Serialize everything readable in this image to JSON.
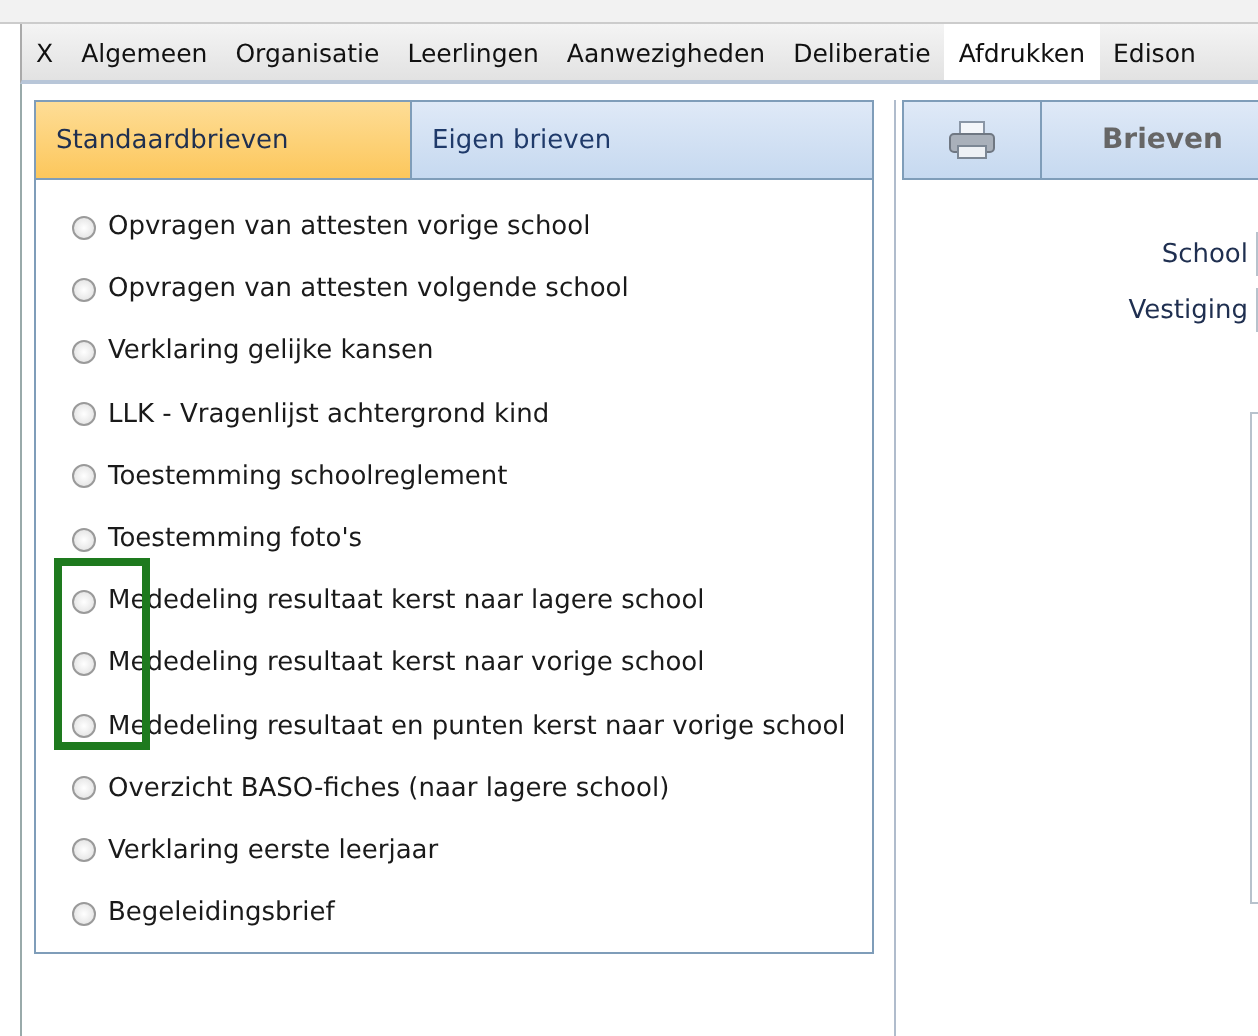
{
  "menu_tabs": [
    {
      "label": "X",
      "selected": false
    },
    {
      "label": "Algemeen",
      "selected": false
    },
    {
      "label": "Organisatie",
      "selected": false
    },
    {
      "label": "Leerlingen",
      "selected": false
    },
    {
      "label": "Aanwezigheden",
      "selected": false
    },
    {
      "label": "Deliberatie",
      "selected": false
    },
    {
      "label": "Afdrukken",
      "selected": true
    },
    {
      "label": "Edison",
      "selected": false
    }
  ],
  "letter_tabs": [
    {
      "label": "Standaardbrieven",
      "selected": true
    },
    {
      "label": "Eigen brieven",
      "selected": false
    }
  ],
  "letters": [
    {
      "label": "Opvragen van attesten vorige school",
      "selected": false
    },
    {
      "label": "Opvragen van attesten volgende school",
      "selected": false
    },
    {
      "label": "Verklaring gelijke kansen",
      "selected": false
    },
    {
      "label": "LLK - Vragenlijst achtergrond kind",
      "selected": false
    },
    {
      "label": "Toestemming schoolreglement",
      "selected": false
    },
    {
      "label": "Toestemming foto's",
      "selected": false
    },
    {
      "label": "Mededeling resultaat kerst naar lagere school",
      "selected": false
    },
    {
      "label": "Mededeling resultaat kerst naar vorige school",
      "selected": false
    },
    {
      "label": "Mededeling resultaat en punten kerst naar vorige school",
      "selected": false
    },
    {
      "label": "Overzicht BASO-fiches (naar lagere school)",
      "selected": false
    },
    {
      "label": "Verklaring eerste leerjaar",
      "selected": false
    },
    {
      "label": "Begeleidingsbrief",
      "selected": false
    }
  ],
  "right_panel": {
    "title": "Brieven",
    "fields": [
      {
        "label": "School"
      },
      {
        "label": "Vestiging"
      }
    ]
  }
}
